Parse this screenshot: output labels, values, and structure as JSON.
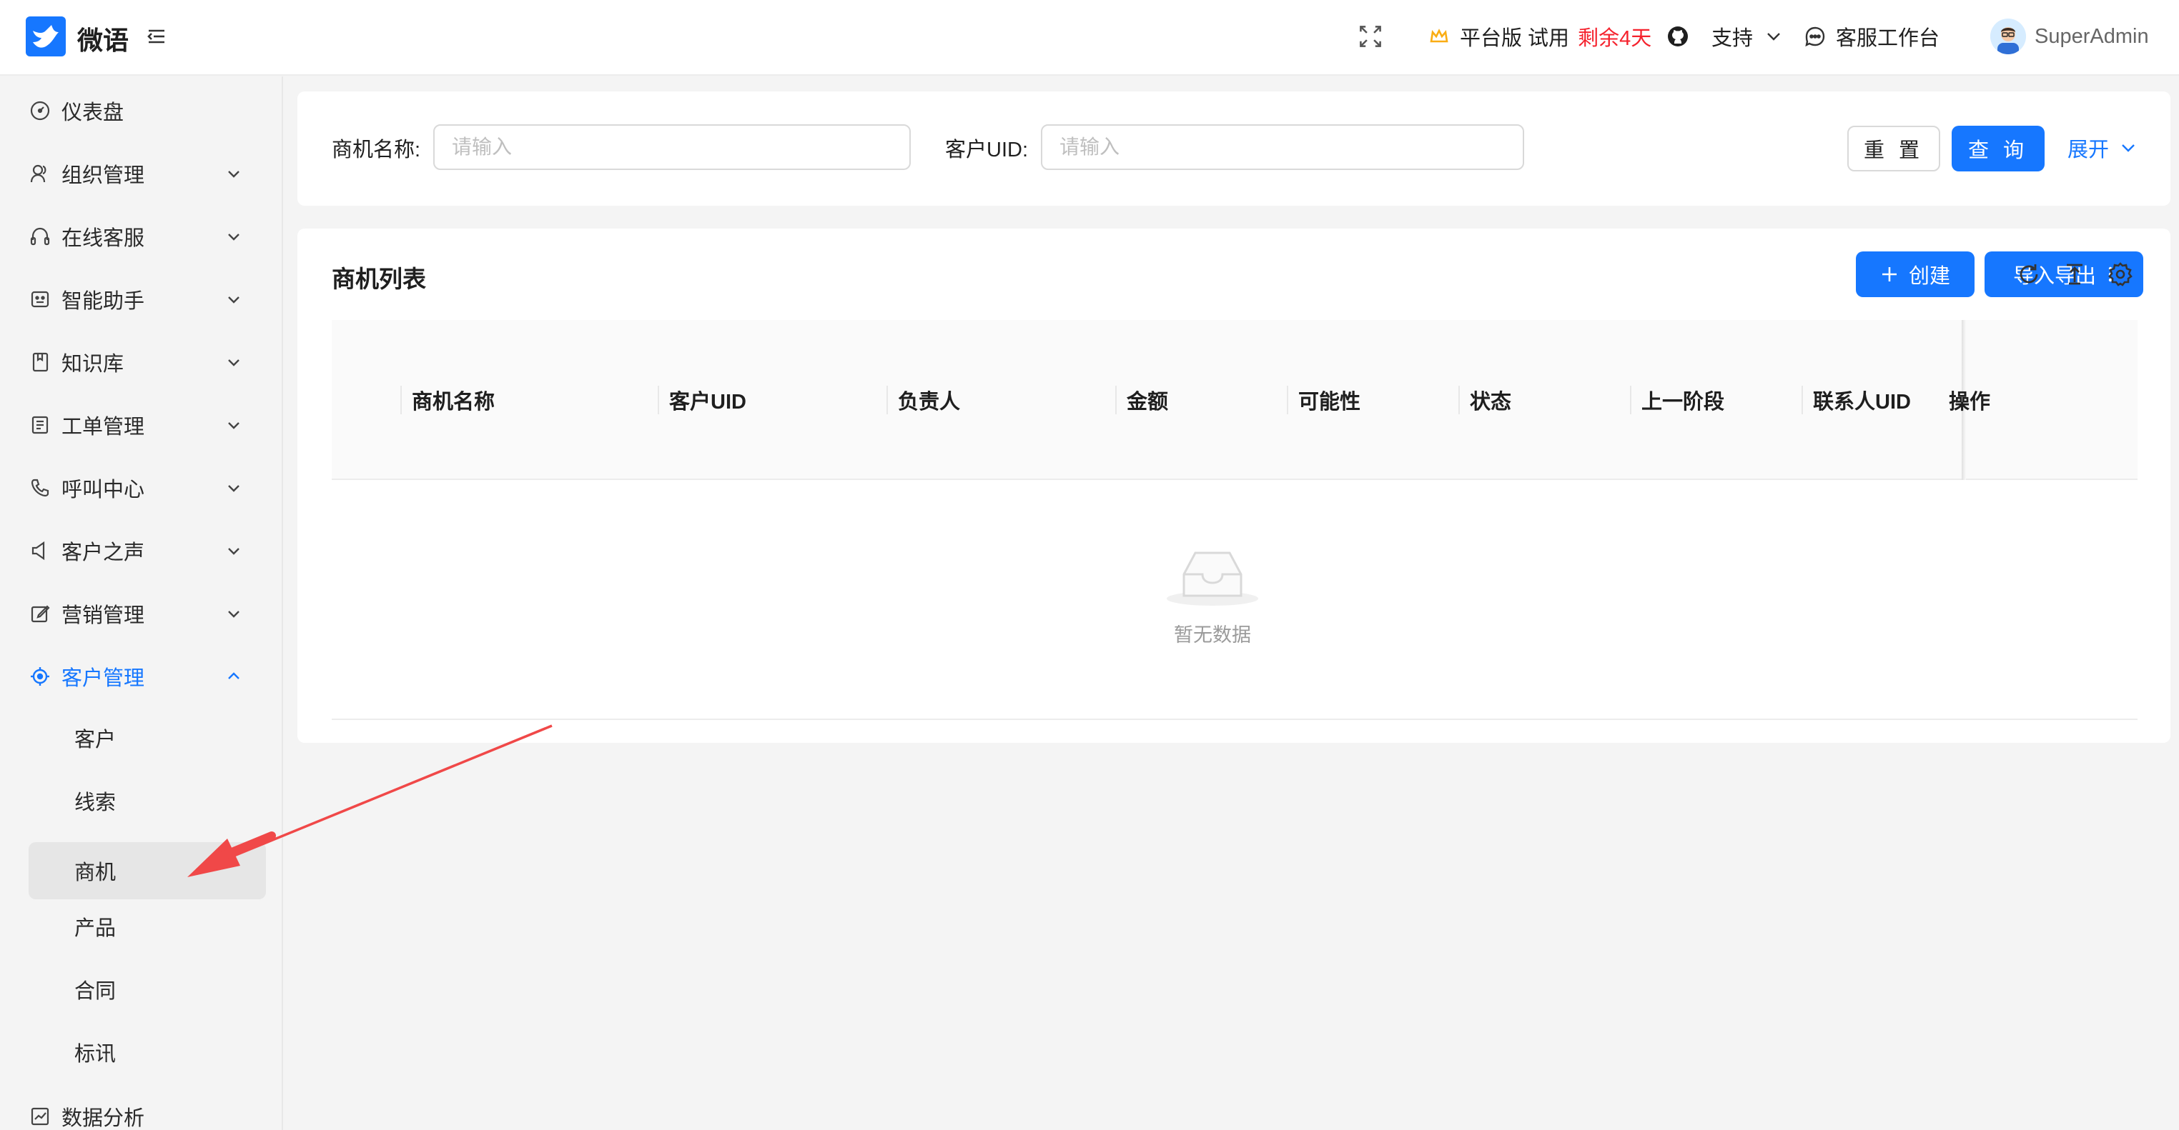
{
  "app": {
    "name": "微语",
    "brand_color": "#1677ff"
  },
  "header": {
    "plan_label": "平台版 试用",
    "trial_remaining": "剩余4天",
    "support_label": "支持",
    "workbench_label": "客服工作台",
    "username": "SuperAdmin"
  },
  "sidebar": {
    "items": [
      {
        "label": "仪表盘",
        "icon": "dashboard-icon"
      },
      {
        "label": "组织管理",
        "icon": "team-icon"
      },
      {
        "label": "在线客服",
        "icon": "headset-icon"
      },
      {
        "label": "智能助手",
        "icon": "robot-icon"
      },
      {
        "label": "知识库",
        "icon": "book-icon"
      },
      {
        "label": "工单管理",
        "icon": "ticket-icon"
      },
      {
        "label": "呼叫中心",
        "icon": "phone-icon"
      },
      {
        "label": "客户之声",
        "icon": "sound-icon"
      },
      {
        "label": "营销管理",
        "icon": "edit-icon"
      },
      {
        "label": "客户管理",
        "icon": "aim-icon"
      },
      {
        "label": "数据分析",
        "icon": "chart-icon"
      }
    ],
    "sub_items": [
      "客户",
      "线索",
      "商机",
      "产品",
      "合同",
      "标讯"
    ],
    "selected_sub": "商机"
  },
  "search": {
    "name_label": "商机名称",
    "name_placeholder": "请输入",
    "uid_label": "客户UID",
    "uid_placeholder": "请输入",
    "reset_label": "重 置",
    "query_label": "查 询",
    "expand_label": "展开"
  },
  "table": {
    "title": "商机列表",
    "create_label": "创建",
    "import_export_label": "导入导出",
    "columns": [
      "商机名称",
      "客户UID",
      "负责人",
      "金额",
      "可能性",
      "状态",
      "上一阶段",
      "联系人UID",
      "操作"
    ],
    "empty_text": "暂无数据"
  },
  "colors": {
    "primary": "#1677ff",
    "danger": "#f5222d",
    "annotation_arrow": "#f04848"
  }
}
